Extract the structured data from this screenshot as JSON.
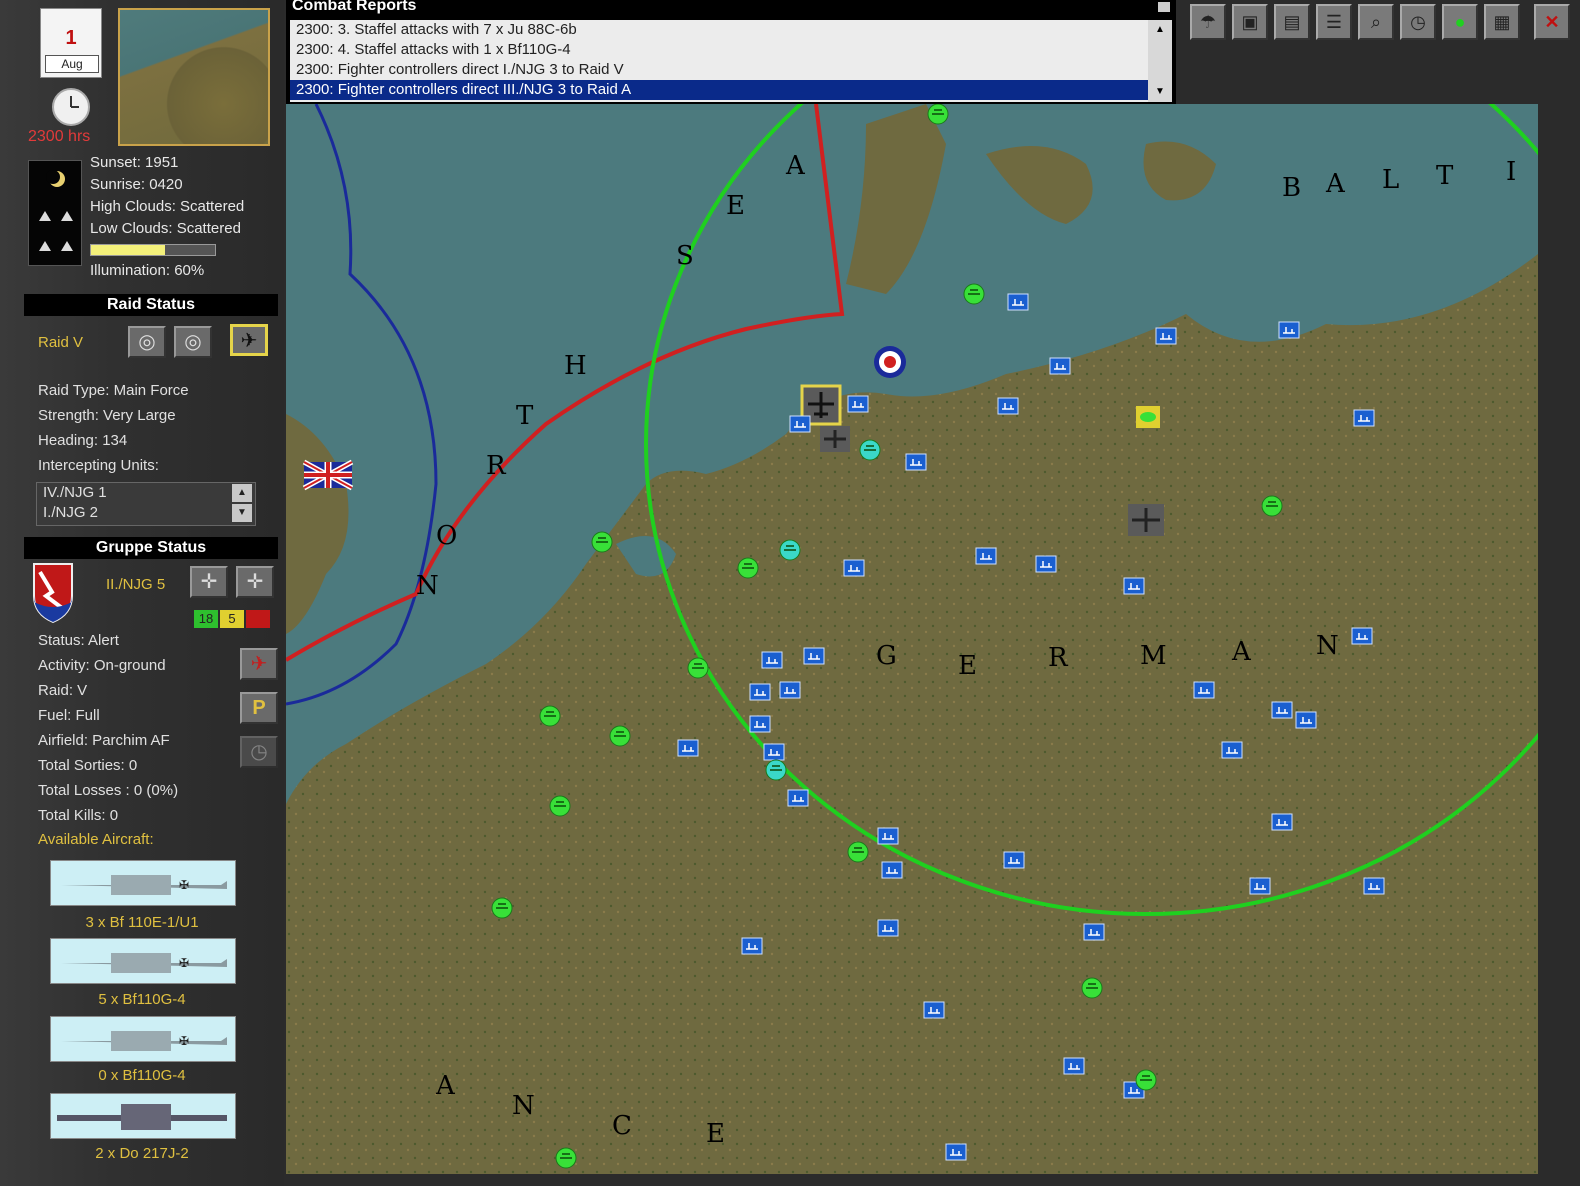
{
  "date": {
    "day": "1",
    "month": "Aug"
  },
  "time": "2300 hrs",
  "weather": {
    "sunset": "Sunset: 1951",
    "sunrise": "Sunrise: 0420",
    "high_clouds": "High Clouds: Scattered",
    "low_clouds": "Low Clouds: Scattered",
    "illumination": "Illumination: 60%",
    "illumination_level": 0.6
  },
  "raid_status": {
    "header": "Raid Status",
    "raid": "Raid V",
    "type": "Raid Type: Main Force",
    "strength": "Strength: Very Large",
    "heading": "Heading: 134",
    "intercepting_label": "Intercepting Units:",
    "intercepting_units": [
      "IV./NJG 1",
      "I./NJG 2"
    ]
  },
  "gruppe_status": {
    "header": "Gruppe Status",
    "unit": "II./NJG 5",
    "counts": [
      "18",
      "5",
      ""
    ],
    "status": "Status: Alert",
    "activity": "Activity: On-ground",
    "raid": "Raid: V",
    "fuel": "Fuel: Full",
    "airfield": "Airfield: Parchim AF",
    "sorties": "Total Sorties:  0",
    "losses": "Total Losses :  0   (0%)",
    "kills": "Total Kills:  0",
    "available_label": "Available Aircraft:",
    "aircraft": [
      "3 x Bf 110E-1/U1",
      "5 x Bf110G-4",
      "0 x Bf110G-4",
      "2 x Do 217J-2"
    ]
  },
  "combat_reports": {
    "title": "Combat Reports",
    "rows": [
      "2300:  3. Staffel attacks with  7 x Ju 88C-6b",
      "2300:  4. Staffel attacks with  1 x Bf110G-4",
      "2300:  Fighter controllers direct I./NJG 3 to Raid V",
      "2300:  Fighter controllers direct III./NJG 3 to Raid A"
    ],
    "selected_index": 3
  },
  "toolbar": [
    "parachute-icon",
    "save-icon",
    "report-icon",
    "list-icon",
    "zoom-icon",
    "stopwatch-icon",
    "status-light-icon",
    "grid-icon",
    "close-icon"
  ],
  "map_labels": {
    "north_sea": [
      "N",
      "O",
      "R",
      "T",
      "H",
      "S",
      "E",
      "A"
    ],
    "baltic": [
      "B",
      "A",
      "L",
      "T",
      "I"
    ],
    "germany": [
      "G",
      "E",
      "R",
      "M",
      "A",
      "N"
    ],
    "france": [
      "A",
      "N",
      "C",
      "E"
    ]
  },
  "colors": {
    "raid_range": "#1fd01f",
    "british_zone": "#d02020",
    "boundary": "#1a2a9a",
    "airfield": "#1a5fd0"
  }
}
